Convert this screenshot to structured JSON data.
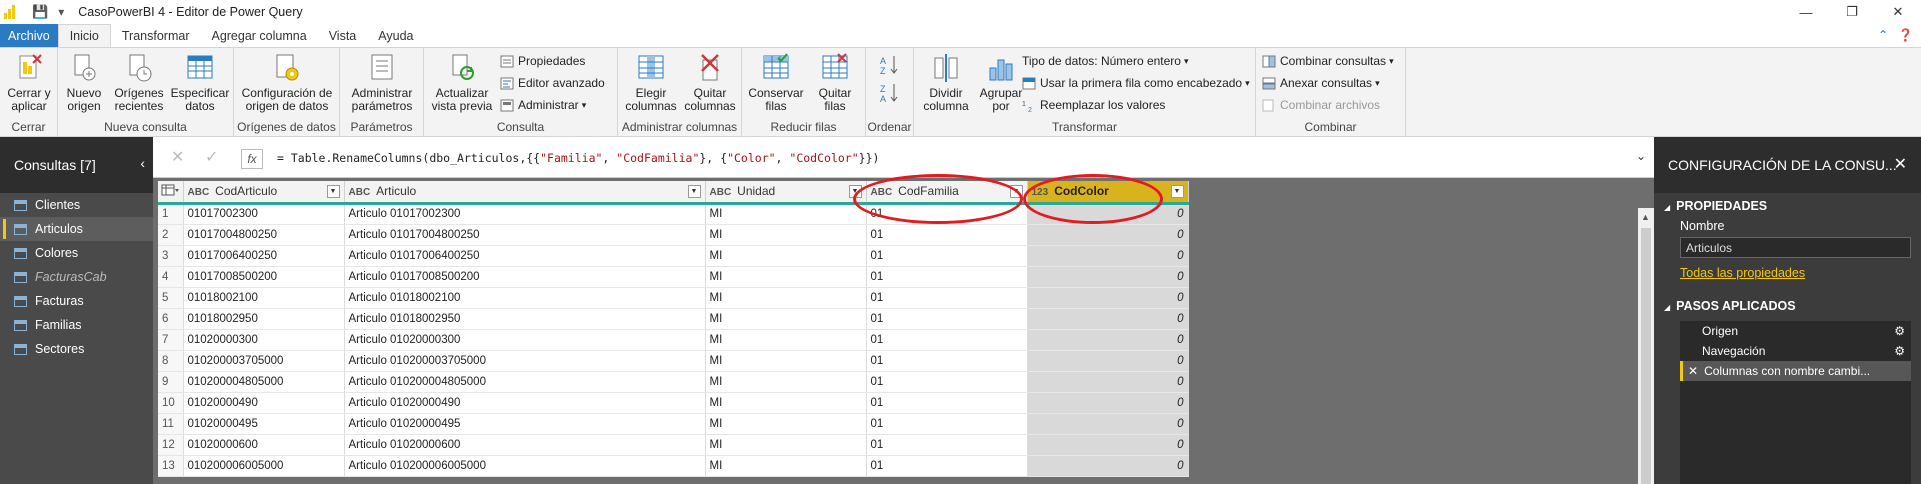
{
  "window": {
    "title": "CasoPowerBI 4 - Editor de Power Query",
    "minimize": "—",
    "maximize": "❐",
    "close": "✕"
  },
  "ribbon_tabs": [
    "Archivo",
    "Inicio",
    "Transformar",
    "Agregar columna",
    "Vista",
    "Ayuda"
  ],
  "ribbon": {
    "groups": {
      "cerrar": "Cerrar",
      "nueva_consulta": "Nueva consulta",
      "origenes": "Orígenes de datos",
      "parametros": "Parámetros",
      "consulta": "Consulta",
      "admin_columnas": "Administrar columnas",
      "reducir_filas": "Reducir filas",
      "ordenar": "Ordenar",
      "transformar": "Transformar",
      "combinar": "Combinar"
    },
    "buttons": {
      "cerrar_aplicar_1": "Cerrar y",
      "cerrar_aplicar_2": "aplicar",
      "nuevo_origen_1": "Nuevo",
      "nuevo_origen_2": "origen",
      "origenes_recientes_1": "Orígenes",
      "origenes_recientes_2": "recientes",
      "especificar_datos_1": "Especificar",
      "especificar_datos_2": "datos",
      "config_origen_1": "Configuración de",
      "config_origen_2": "origen de datos",
      "admin_param_1": "Administrar",
      "admin_param_2": "parámetros",
      "actualizar_1": "Actualizar",
      "actualizar_2": "vista previa",
      "propiedades": "Propiedades",
      "editor_avanzado": "Editor avanzado",
      "administrar": "Administrar",
      "elegir_col_1": "Elegir",
      "elegir_col_2": "columnas",
      "quitar_col_1": "Quitar",
      "quitar_col_2": "columnas",
      "conservar_filas_1": "Conservar",
      "conservar_filas_2": "filas",
      "quitar_filas_1": "Quitar",
      "quitar_filas_2": "filas",
      "dividir_col_1": "Dividir",
      "dividir_col_2": "columna",
      "agrupar_1": "Agrupar",
      "agrupar_2": "por",
      "tipo_datos": "Tipo de datos: Número entero",
      "primera_fila": "Usar la primera fila como encabezado",
      "reemplazar": "Reemplazar los valores",
      "combinar_consultas": "Combinar consultas",
      "anexar_consultas": "Anexar consultas",
      "combinar_archivos": "Combinar archivos"
    }
  },
  "left_panel": {
    "title": "Consultas [7]",
    "queries": [
      {
        "label": "Clientes",
        "selected": false,
        "italic": false
      },
      {
        "label": "Articulos",
        "selected": true,
        "italic": false
      },
      {
        "label": "Colores",
        "selected": false,
        "italic": false
      },
      {
        "label": "FacturasCab",
        "selected": false,
        "italic": true
      },
      {
        "label": "Facturas",
        "selected": false,
        "italic": false
      },
      {
        "label": "Familias",
        "selected": false,
        "italic": false
      },
      {
        "label": "Sectores",
        "selected": false,
        "italic": false
      }
    ]
  },
  "formula_bar": {
    "cancel": "✕",
    "confirm": "✓",
    "fx": "fx",
    "formula_prefix": "= Table.RenameColumns(dbo_Articulos,{{",
    "s1": "\"Familia\"",
    "c1": ", ",
    "s2": "\"CodFamilia\"",
    "c2": "}, {",
    "s3": "\"Color\"",
    "c3": ", ",
    "s4": "\"CodColor\"",
    "formula_suffix": "}})"
  },
  "grid": {
    "columns": [
      {
        "type": "ABC",
        "name": "CodArticulo"
      },
      {
        "type": "ABC",
        "name": "Articulo"
      },
      {
        "type": "ABC",
        "name": "Unidad"
      },
      {
        "type": "ABC",
        "name": "CodFamilia"
      },
      {
        "type": "123",
        "name": "CodColor"
      }
    ],
    "rows": [
      [
        "1",
        "01017002300",
        "Articulo 01017002300",
        "MI",
        "01",
        "0"
      ],
      [
        "2",
        "01017004800250",
        "Articulo 01017004800250",
        "MI",
        "01",
        "0"
      ],
      [
        "3",
        "01017006400250",
        "Articulo 01017006400250",
        "MI",
        "01",
        "0"
      ],
      [
        "4",
        "01017008500200",
        "Articulo 01017008500200",
        "MI",
        "01",
        "0"
      ],
      [
        "5",
        "01018002100",
        "Articulo 01018002100",
        "MI",
        "01",
        "0"
      ],
      [
        "6",
        "01018002950",
        "Articulo 01018002950",
        "MI",
        "01",
        "0"
      ],
      [
        "7",
        "01020000300",
        "Articulo 01020000300",
        "MI",
        "01",
        "0"
      ],
      [
        "8",
        "010200003705000",
        "Articulo 010200003705000",
        "MI",
        "01",
        "0"
      ],
      [
        "9",
        "010200004805000",
        "Articulo 010200004805000",
        "MI",
        "01",
        "0"
      ],
      [
        "10",
        "01020000490",
        "Articulo 01020000490",
        "MI",
        "01",
        "0"
      ],
      [
        "11",
        "01020000495",
        "Articulo 01020000495",
        "MI",
        "01",
        "0"
      ],
      [
        "12",
        "01020000600",
        "Articulo 01020000600",
        "MI",
        "01",
        "0"
      ],
      [
        "13",
        "010200006005000",
        "Articulo 010200006005000",
        "MI",
        "01",
        "0"
      ]
    ]
  },
  "right_panel": {
    "title": "CONFIGURACIÓN DE LA CONSU...",
    "close": "✕",
    "properties_title": "PROPIEDADES",
    "name_label": "Nombre",
    "name_value": "Articulos",
    "all_props_link": "Todas las propiedades",
    "steps_title": "PASOS APLICADOS",
    "steps": [
      {
        "label": "Origen",
        "gear": true,
        "selected": false
      },
      {
        "label": "Navegación",
        "gear": true,
        "selected": false
      },
      {
        "label": "Columnas con nombre cambi...",
        "gear": false,
        "selected": true
      }
    ]
  },
  "colors": {
    "file_tab": "#2b7bc4",
    "accent_yellow": "#f2c811",
    "header_underline": "#27a993",
    "selected_column": "#d9b31e",
    "annotation_ring": "#e21b23"
  }
}
